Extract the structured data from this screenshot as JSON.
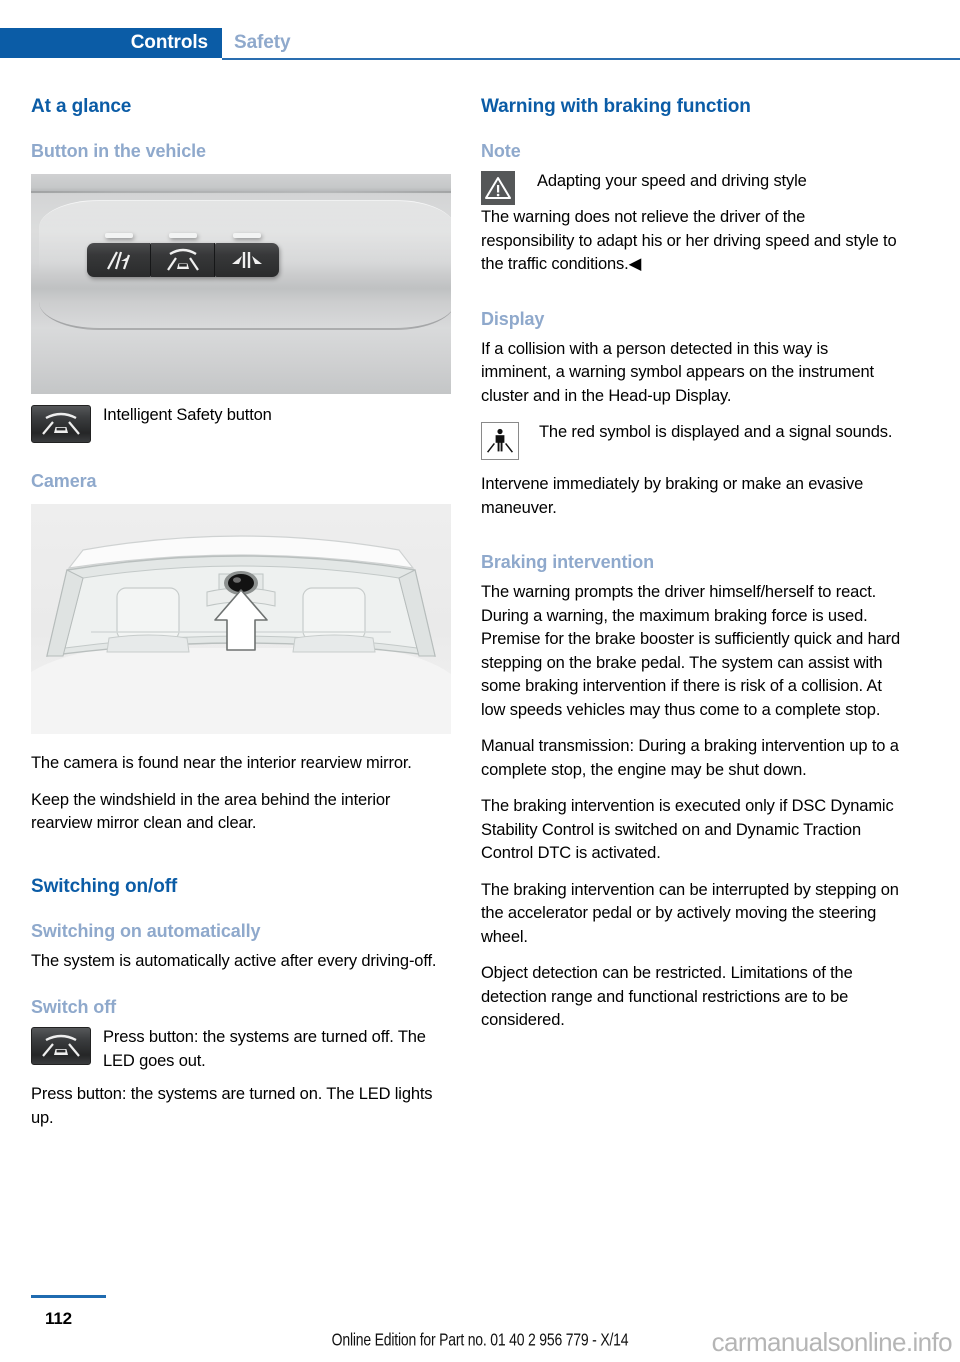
{
  "header": {
    "active_tab": "Controls",
    "inactive_tab": "Safety",
    "active_bg": "#0b5ca6",
    "inactive_color": "#8fa9cc"
  },
  "left_column": {
    "h_at_a_glance": "At a glance",
    "h_button_in_vehicle": "Button in the vehicle",
    "intelligent_safety_caption": "Intelligent Safety button",
    "h_camera": "Camera",
    "camera_p1": "The camera is found near the interior rearview mirror.",
    "camera_p2": "Keep the windshield in the area behind the interior rearview mirror clean and clear.",
    "h_switching_on_off": "Switching on/off",
    "h_switching_on_automatically": "Switching on automatically",
    "auto_p1": "The system is automatically active after every driving-off.",
    "h_switch_off": "Switch off",
    "switch_off_icon_text": "Press button: the systems are turned off. The LED goes out.",
    "switch_off_p1": "Press button: the systems are turned on. The LED lights up."
  },
  "right_column": {
    "h_warning_with_braking": "Warning with braking function",
    "h_note": "Note",
    "note_line1": "Adapting your speed and driving style",
    "note_body": "The warning does not relieve the driver of the responsibility to adapt his or her driving speed and style to the traffic conditions.◀",
    "h_display": "Display",
    "display_p1": "If a collision with a person detected in this way is imminent, a warning symbol appears on the instrument cluster and in the Head-up Display.",
    "display_icon_text": "The red symbol is displayed and a signal sounds.",
    "display_p2": "Intervene immediately by braking or make an evasive maneuver.",
    "h_braking_intervention": "Braking intervention",
    "braking_p1": "The warning prompts the driver himself/herself to react. During a warning, the maximum braking force is used. Premise for the brake booster is sufficiently quick and hard stepping on the brake pedal. The system can assist with some braking intervention if there is risk of a collision. At low speeds vehicles may thus come to a complete stop.",
    "braking_p2": "Manual transmission: During a braking intervention up to a complete stop, the engine may be shut down.",
    "braking_p3": "The braking intervention is executed only if DSC Dynamic Stability Control is switched on and Dynamic Traction Control DTC is activated.",
    "braking_p4": "The braking intervention can be interrupted by stepping on the accelerator pedal or by actively moving the steering wheel.",
    "braking_p5": "Object detection can be restricted. Limitations of the detection range and functional restrictions are to be considered."
  },
  "footer": {
    "page_number": "112",
    "edition_note": "Online Edition for Part no. 01 40 2 956 779 - X/14",
    "watermark": "carmanualsonline.info"
  },
  "icons": {
    "lane_departure": "lane-departure-warning-icon",
    "intelligent_safety": "intelligent-safety-icon",
    "high_beam_assist": "high-beam-assistant-icon",
    "warning_triangle": "warning-triangle-icon",
    "pedestrian_warning": "pedestrian-warning-icon"
  },
  "colors": {
    "heading_primary": "#0b5ca6",
    "heading_secondary": "#8fa9cc",
    "rule": "#1f6bb0"
  }
}
